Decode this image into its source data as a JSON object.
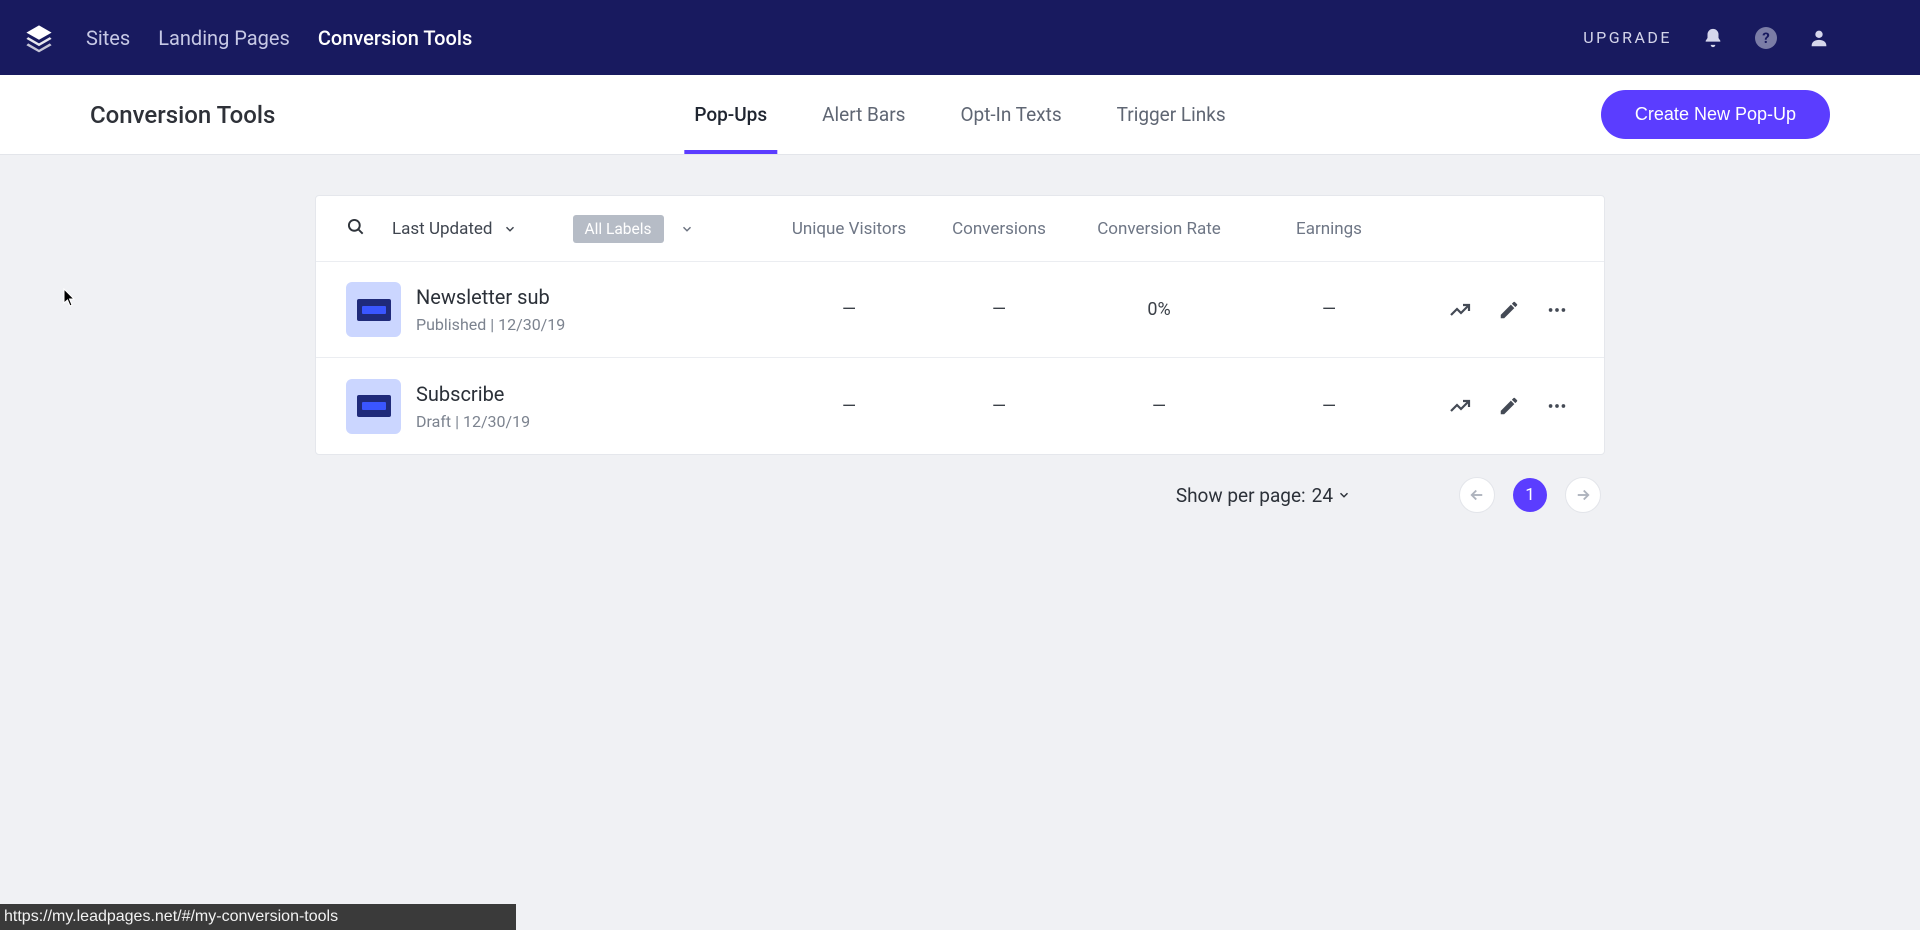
{
  "topnav": {
    "links": [
      "Sites",
      "Landing Pages",
      "Conversion Tools"
    ],
    "active_index": 2,
    "upgrade": "UPGRADE"
  },
  "subheader": {
    "title": "Conversion Tools",
    "tabs": [
      "Pop-Ups",
      "Alert Bars",
      "Opt-In Texts",
      "Trigger Links"
    ],
    "active_tab_index": 0,
    "create_button": "Create New Pop-Up"
  },
  "toolbar": {
    "sort_label": "Last Updated",
    "labels_chip": "All Labels"
  },
  "columns": {
    "unique_visitors": "Unique Visitors",
    "conversions": "Conversions",
    "conversion_rate": "Conversion Rate",
    "earnings": "Earnings"
  },
  "rows": [
    {
      "title": "Newsletter sub",
      "status": "Published",
      "date": "12/30/19",
      "uv": "—",
      "conv": "—",
      "cr": "0%",
      "earn": "—"
    },
    {
      "title": "Subscribe",
      "status": "Draft",
      "date": "12/30/19",
      "uv": "—",
      "conv": "—",
      "cr": "—",
      "earn": "—"
    }
  ],
  "pagination": {
    "per_page_label": "Show per page:",
    "per_page_value": "24",
    "current_page": "1"
  },
  "statusbar": {
    "text": "https://my.leadpages.net/#/my-conversion-tools"
  }
}
